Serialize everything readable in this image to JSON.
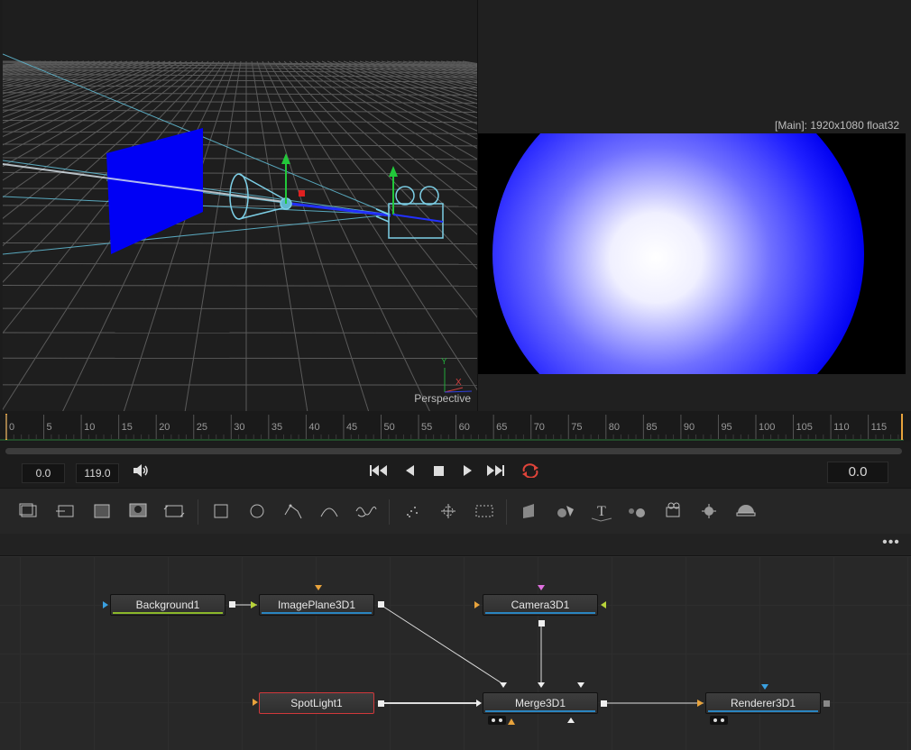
{
  "viewer_left": {
    "label": "Perspective",
    "axis_y": "Y",
    "axis_x": "X"
  },
  "viewer_right": {
    "label": "[Main]: 1920x1080 float32"
  },
  "timeline": {
    "ticks": [
      "0",
      "5",
      "10",
      "15",
      "20",
      "25",
      "30",
      "35",
      "40",
      "45",
      "50",
      "55",
      "60",
      "65",
      "70",
      "75",
      "80",
      "85",
      "90",
      "95",
      "100",
      "105",
      "110",
      "115"
    ]
  },
  "transport": {
    "start": "0.0",
    "end": "119.0",
    "current": "0.0",
    "buttons": {
      "speaker": "speaker-icon",
      "first": "skip-to-start-icon",
      "reverse": "play-reverse-icon",
      "stop": "stop-icon",
      "play": "play-icon",
      "last": "skip-to-end-icon",
      "loop": "loop-icon"
    }
  },
  "toolbar": {
    "tools": [
      "background-tool-icon",
      "paint-tool-icon",
      "text-tool-icon",
      "merge-tool-icon",
      "transform-tool-icon",
      "rectangle-mask-icon",
      "ellipse-mask-icon",
      "polygon-mask-icon",
      "bspline-mask-icon",
      "paint-mask-icon",
      "particle-emitter-icon",
      "particle-render-icon",
      "particle-style-icon",
      "image-plane-3d-icon",
      "shape-3d-icon",
      "text-3d-icon",
      "merge-3d-icon",
      "camera-3d-icon",
      "light-3d-icon",
      "renderer-3d-icon"
    ]
  },
  "node_panel": {
    "more": "•••"
  },
  "nodes": {
    "background": "Background1",
    "imageplane": "ImagePlane3D1",
    "camera": "Camera3D1",
    "spotlight": "SpotLight1",
    "merge": "Merge3D1",
    "renderer": "Renderer3D1"
  },
  "colors": {
    "accent_orange": "#e8a33c",
    "loop_red": "#e0443a",
    "node_selected": "#d0383b",
    "image_plane_blue": "#0000ff"
  }
}
